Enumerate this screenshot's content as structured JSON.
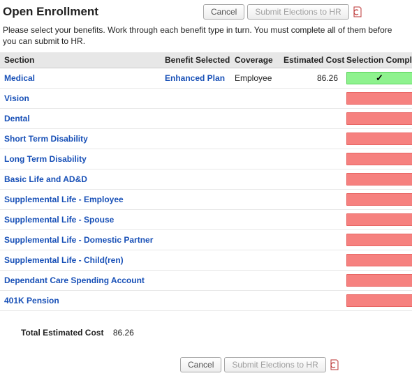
{
  "header": {
    "title": "Open Enrollment",
    "cancel_label": "Cancel",
    "submit_label": "Submit Elections to HR"
  },
  "instructions": "Please select your benefits.   Work through each benefit type in turn.  You must complete all of them before you can submit to HR.",
  "columns": {
    "section": "Section",
    "benefit": "Benefit Selected",
    "coverage": "Coverage",
    "cost": "Estimated Cost",
    "complete": "Selection Completed"
  },
  "rows": [
    {
      "section": "Medical",
      "benefit": "Enhanced Plan",
      "coverage": "Employee",
      "cost": "86.26",
      "completed": true
    },
    {
      "section": "Vision",
      "benefit": "",
      "coverage": "",
      "cost": "",
      "completed": false
    },
    {
      "section": "Dental",
      "benefit": "",
      "coverage": "",
      "cost": "",
      "completed": false
    },
    {
      "section": "Short Term Disability",
      "benefit": "",
      "coverage": "",
      "cost": "",
      "completed": false
    },
    {
      "section": "Long Term Disability",
      "benefit": "",
      "coverage": "",
      "cost": "",
      "completed": false
    },
    {
      "section": "Basic Life and AD&D",
      "benefit": "",
      "coverage": "",
      "cost": "",
      "completed": false
    },
    {
      "section": "Supplemental Life - Employee",
      "benefit": "",
      "coverage": "",
      "cost": "",
      "completed": false
    },
    {
      "section": "Supplemental Life - Spouse",
      "benefit": "",
      "coverage": "",
      "cost": "",
      "completed": false
    },
    {
      "section": "Supplemental Life - Domestic Partner",
      "benefit": "",
      "coverage": "",
      "cost": "",
      "completed": false
    },
    {
      "section": "Supplemental Life - Child(ren)",
      "benefit": "",
      "coverage": "",
      "cost": "",
      "completed": false
    },
    {
      "section": "Dependant Care Spending Account",
      "benefit": "",
      "coverage": "",
      "cost": "",
      "completed": false
    },
    {
      "section": "401K Pension",
      "benefit": "",
      "coverage": "",
      "cost": "",
      "completed": false
    }
  ],
  "total": {
    "label": "Total Estimated Cost",
    "value": "86.26"
  },
  "footer": {
    "cancel_label": "Cancel",
    "submit_label": "Submit Elections to HR"
  },
  "colors": {
    "link": "#1850b7",
    "complete_bg": "#8ef28e",
    "incomplete_bg": "#f6817f"
  }
}
